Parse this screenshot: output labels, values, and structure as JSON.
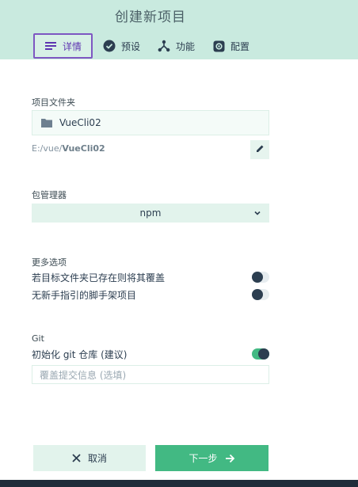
{
  "header": {
    "title": "创建新项目",
    "tabs": [
      {
        "label": "详情",
        "icon": "list-icon",
        "active": true
      },
      {
        "label": "预设",
        "icon": "check-circle-icon",
        "active": false
      },
      {
        "label": "功能",
        "icon": "fork-icon",
        "active": false
      },
      {
        "label": "配置",
        "icon": "gear-icon",
        "active": false
      }
    ]
  },
  "folder": {
    "label": "项目文件夹",
    "value": "VueCli02",
    "path_prefix": "E:/vue/",
    "path_name": "VueCli02"
  },
  "package_manager": {
    "label": "包管理器",
    "selected": "npm"
  },
  "more_options": {
    "label": "更多选项",
    "items": [
      {
        "label": "若目标文件夹已存在则将其覆盖",
        "enabled": false
      },
      {
        "label": "无新手指引的脚手架项目",
        "enabled": false
      }
    ]
  },
  "git": {
    "label": "Git",
    "init_label": "初始化 git 仓库 (建议)",
    "init_enabled": true,
    "commit_placeholder": "覆盖提交信息 (选填)"
  },
  "actions": {
    "cancel": "取消",
    "next": "下一步"
  },
  "colors": {
    "header_bg": "#c9eadf",
    "accent": "#42b983",
    "active_tab_border": "#7e57c2",
    "dark": "#2c3e50"
  }
}
